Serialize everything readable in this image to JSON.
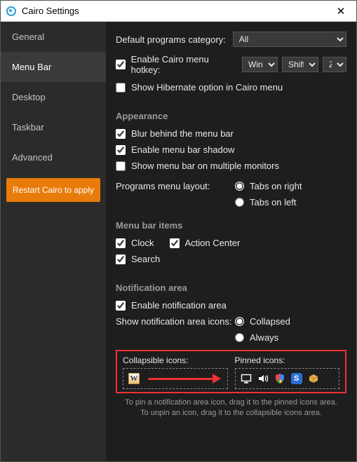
{
  "window_title": "Cairo Settings",
  "nav": {
    "items": [
      "General",
      "Menu Bar",
      "Desktop",
      "Taskbar",
      "Advanced"
    ],
    "active": 1,
    "restart": "Restart Cairo to apply"
  },
  "defaults": {
    "category_label": "Default programs category:",
    "category_value": "All",
    "hotkey_label": "Enable Cairo menu hotkey:",
    "hotkey_checked": true,
    "hotkey_mod1": "Win",
    "hotkey_mod2": "Shift",
    "hotkey_key": "Z",
    "hibernate_label": "Show Hibernate option in Cairo menu",
    "hibernate_checked": false
  },
  "appearance": {
    "heading": "Appearance",
    "blur_label": "Blur behind the menu bar",
    "blur_checked": true,
    "shadow_label": "Enable menu bar shadow",
    "shadow_checked": true,
    "multi_label": "Show menu bar on multiple monitors",
    "multi_checked": false,
    "layout_label": "Programs menu layout:",
    "layout_opt1": "Tabs on right",
    "layout_opt2": "Tabs on left",
    "layout_value": "right"
  },
  "items": {
    "heading": "Menu bar items",
    "clock_label": "Clock",
    "clock_checked": true,
    "action_label": "Action Center",
    "action_checked": true,
    "search_label": "Search",
    "search_checked": true
  },
  "notif": {
    "heading": "Notification area",
    "enable_label": "Enable notification area",
    "enable_checked": true,
    "show_label": "Show notification area icons:",
    "show_opt1": "Collapsed",
    "show_opt2": "Always",
    "show_value": "collapsed",
    "collapsible_label": "Collapsible icons:",
    "pinned_label": "Pinned icons:",
    "hint": "To pin a notification area icon, drag it to the pinned icons area. To unpin an icon, drag it to the collapsible icons area."
  }
}
